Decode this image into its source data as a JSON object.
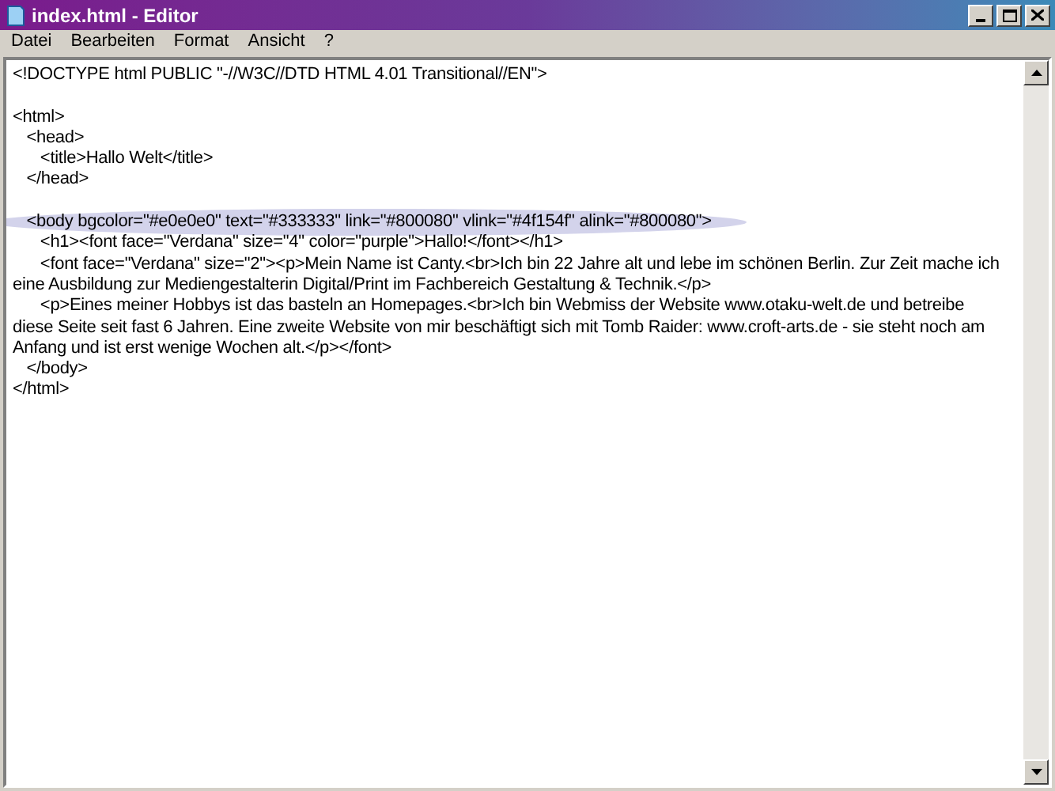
{
  "window": {
    "title": "index.html - Editor"
  },
  "menu": [
    "Datei",
    "Bearbeiten",
    "Format",
    "Ansicht",
    "?"
  ],
  "editor": {
    "lines": [
      {
        "text": "<!DOCTYPE html PUBLIC \"-//W3C//DTD HTML 4.01 Transitional//EN\">",
        "highlighted": false
      },
      {
        "highlighted": false
      },
      {
        "text": "<html>",
        "highlighted": false
      },
      {
        "text": "   <head>",
        "highlighted": false
      },
      {
        "text": "      <title>Hallo Welt</title>",
        "highlighted": false
      },
      {
        "text": "   </head>",
        "highlighted": false
      },
      {
        "highlighted": false
      },
      {
        "text": "   <body bgcolor=\"#e0e0e0\" text=\"#333333\" link=\"#800080\" vlink=\"#4f154f\" alink=\"#800080\">",
        "highlighted": true
      },
      {
        "text": "      <h1><font face=\"Verdana\" size=\"4\" color=\"purple\">Hallo!</font></h1>",
        "highlighted": false
      },
      {
        "text": "      <font face=\"Verdana\" size=\"2\"><p>Mein Name ist Canty.<br>Ich bin 22 Jahre alt und lebe im schönen Berlin. Zur Zeit mache ich",
        "highlighted": false
      },
      {
        "text": "eine Ausbildung zur Mediengestalterin Digital/Print im Fachbereich Gestaltung & Technik.</p>",
        "highlighted": false
      },
      {
        "text": "      <p>Eines meiner Hobbys ist das basteln an Homepages.<br>Ich bin Webmiss der Website www.otaku-welt.de und betreibe",
        "highlighted": false
      },
      {
        "text": "diese Seite seit fast 6 Jahren. Eine zweite Website von mir beschäftigt sich mit Tomb Raider: www.croft-arts.de - sie steht noch am",
        "highlighted": false
      },
      {
        "text": "Anfang und ist erst wenige Wochen alt.</p></font>",
        "highlighted": false
      },
      {
        "text": "   </body>",
        "highlighted": false
      },
      {
        "text": "</html>",
        "highlighted": false
      }
    ]
  }
}
